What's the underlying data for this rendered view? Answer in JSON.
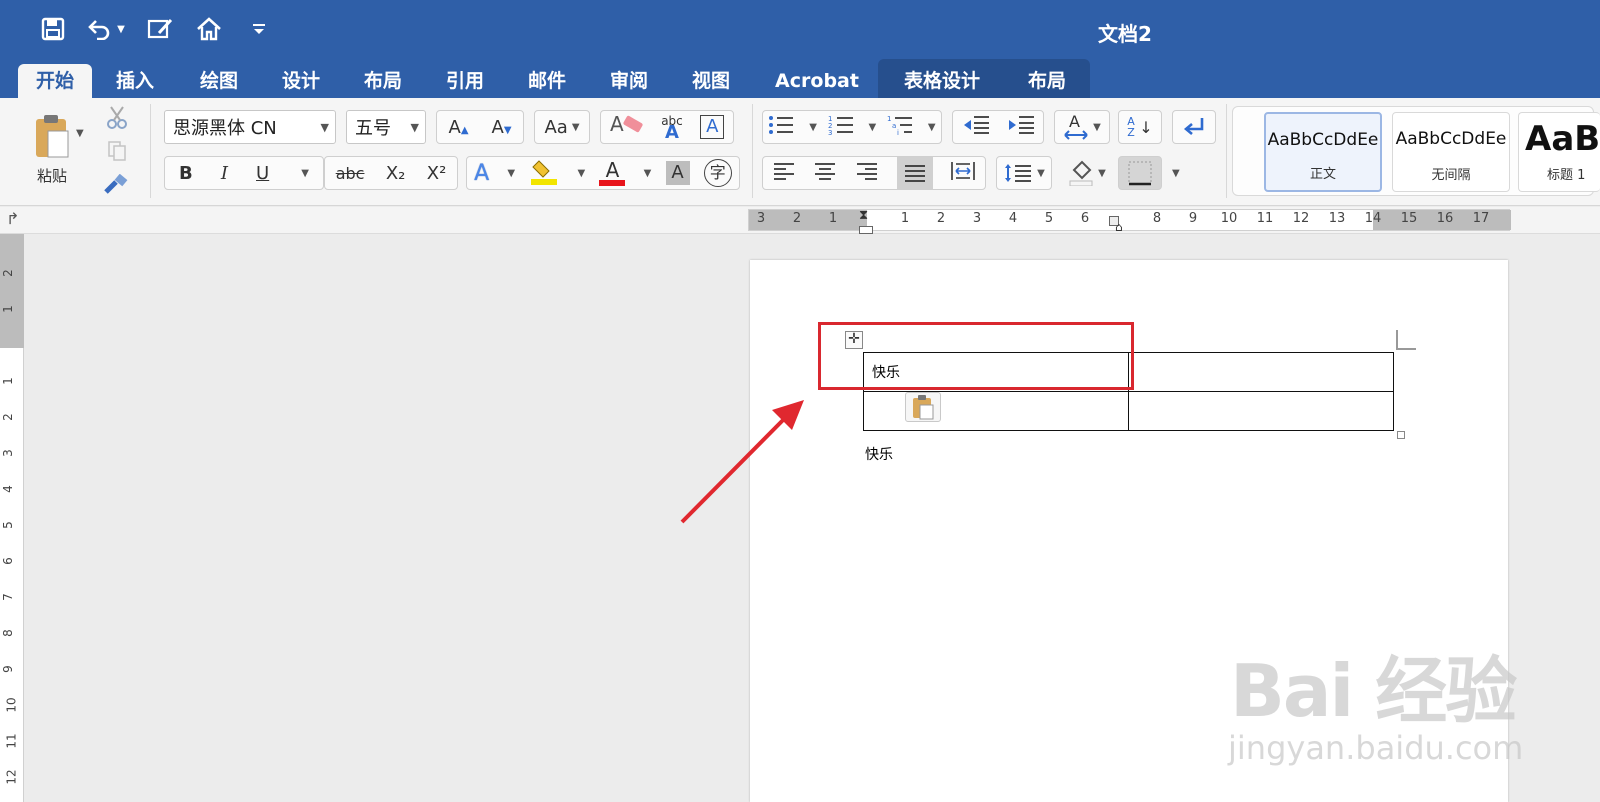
{
  "app": {
    "document_title": "文档2"
  },
  "tabs": [
    {
      "label": "开始",
      "active": true
    },
    {
      "label": "插入"
    },
    {
      "label": "绘图"
    },
    {
      "label": "设计"
    },
    {
      "label": "布局"
    },
    {
      "label": "引用"
    },
    {
      "label": "邮件"
    },
    {
      "label": "审阅"
    },
    {
      "label": "视图"
    },
    {
      "label": "Acrobat"
    },
    {
      "label": "表格设计",
      "contextual": true
    },
    {
      "label": "布局",
      "contextual": true
    }
  ],
  "ribbon": {
    "paste_label": "粘贴",
    "font_name": "思源黑体 CN",
    "font_size": "五号",
    "bold": "B",
    "italic": "I",
    "underline": "U",
    "strikethrough": "abc",
    "subscript": "X₂",
    "superscript": "X²",
    "grow_font": "A",
    "shrink_font": "A",
    "change_case": "Aa",
    "clear_format_abc": "abc",
    "char_border": "A",
    "text_effects": "A",
    "font_color": "A",
    "char_shading": "A",
    "phonetic": "字",
    "sort_label": "A Z",
    "styles": [
      {
        "sample": "AaBbCcDdEe",
        "name": "正文",
        "selected": true
      },
      {
        "sample": "AaBbCcDdEe",
        "name": "无间隔"
      },
      {
        "sample": "AaBl",
        "name": "标题 1"
      }
    ],
    "colors": {
      "highlight": "#f2e500",
      "font_color": "#e8141b"
    }
  },
  "ruler": {
    "horizontal_left": [
      "3",
      "2",
      "1"
    ],
    "horizontal_right": [
      "1",
      "2",
      "3",
      "4",
      "5",
      "6",
      "8",
      "9",
      "10",
      "11",
      "12",
      "13",
      "14",
      "15",
      "16",
      "17"
    ],
    "vertical": [
      "2",
      "1",
      "1",
      "2",
      "3",
      "4",
      "5",
      "6",
      "7",
      "8",
      "9",
      "10",
      "11",
      "12"
    ]
  },
  "document": {
    "table": [
      [
        "快乐",
        ""
      ],
      [
        "",
        ""
      ]
    ],
    "paragraph": "快乐"
  },
  "watermark": {
    "main": "Bai 经验",
    "sub": "jingyan.baidu.com"
  }
}
